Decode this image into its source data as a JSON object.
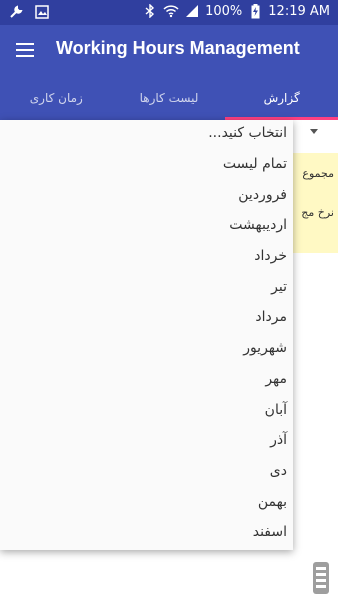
{
  "status_bar": {
    "battery": "100%",
    "time": "12:19 AM",
    "icons": [
      "wrench-icon",
      "image-icon",
      "bluetooth-icon",
      "wifi-icon",
      "signal-icon",
      "battery-charging-icon"
    ]
  },
  "app_bar": {
    "title": "Working Hours Management",
    "menu_icon": "hamburger-menu-icon"
  },
  "tabs": [
    {
      "label": "گزارش",
      "active": true
    },
    {
      "label": "لیست کارها",
      "active": false
    },
    {
      "label": "زمان کاری",
      "active": false
    }
  ],
  "background_card": {
    "row1": "مجموع",
    "row2": "نرخ مج"
  },
  "month_dropdown": {
    "options": [
      "انتخاب کنید...",
      "تمام لیست",
      "فروردین",
      "اردیبهشت",
      "خرداد",
      "تیر",
      "مرداد",
      "شهریور",
      "مهر",
      "آبان",
      "آذر",
      "دی",
      "بهمن",
      "اسفند"
    ]
  },
  "colors": {
    "status_bar": "#303f9f",
    "primary": "#3f51b5",
    "tab_indicator": "#ff4081",
    "card_background": "#fff9c4"
  }
}
